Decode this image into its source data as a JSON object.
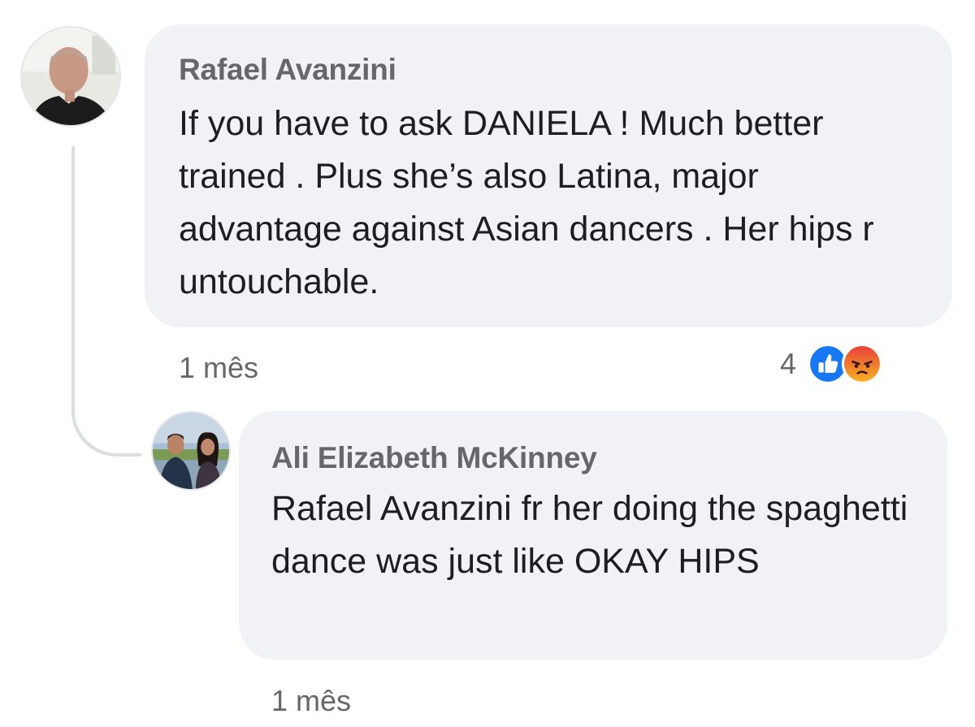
{
  "comments": [
    {
      "author": "Rafael Avanzini",
      "text": "If you have to ask DANIELA ! Much better trained . Plus she’s also Latina, major advantage against Asian dancers . Her hips r untouchable.",
      "time": "1 mês",
      "reactions": {
        "count": "4",
        "icons": [
          "like-icon",
          "angry-icon"
        ]
      }
    },
    {
      "author": "Ali Elizabeth McKinney",
      "text": "Rafael Avanzini fr her doing the spaghetti dance was just like OKAY HIPS",
      "time": "1 mês"
    }
  ],
  "colors": {
    "bubble": "#f0f2f5",
    "author": "#65676b",
    "text": "#1c1e21",
    "like": "#1877f2",
    "angry": "#f0524a"
  }
}
